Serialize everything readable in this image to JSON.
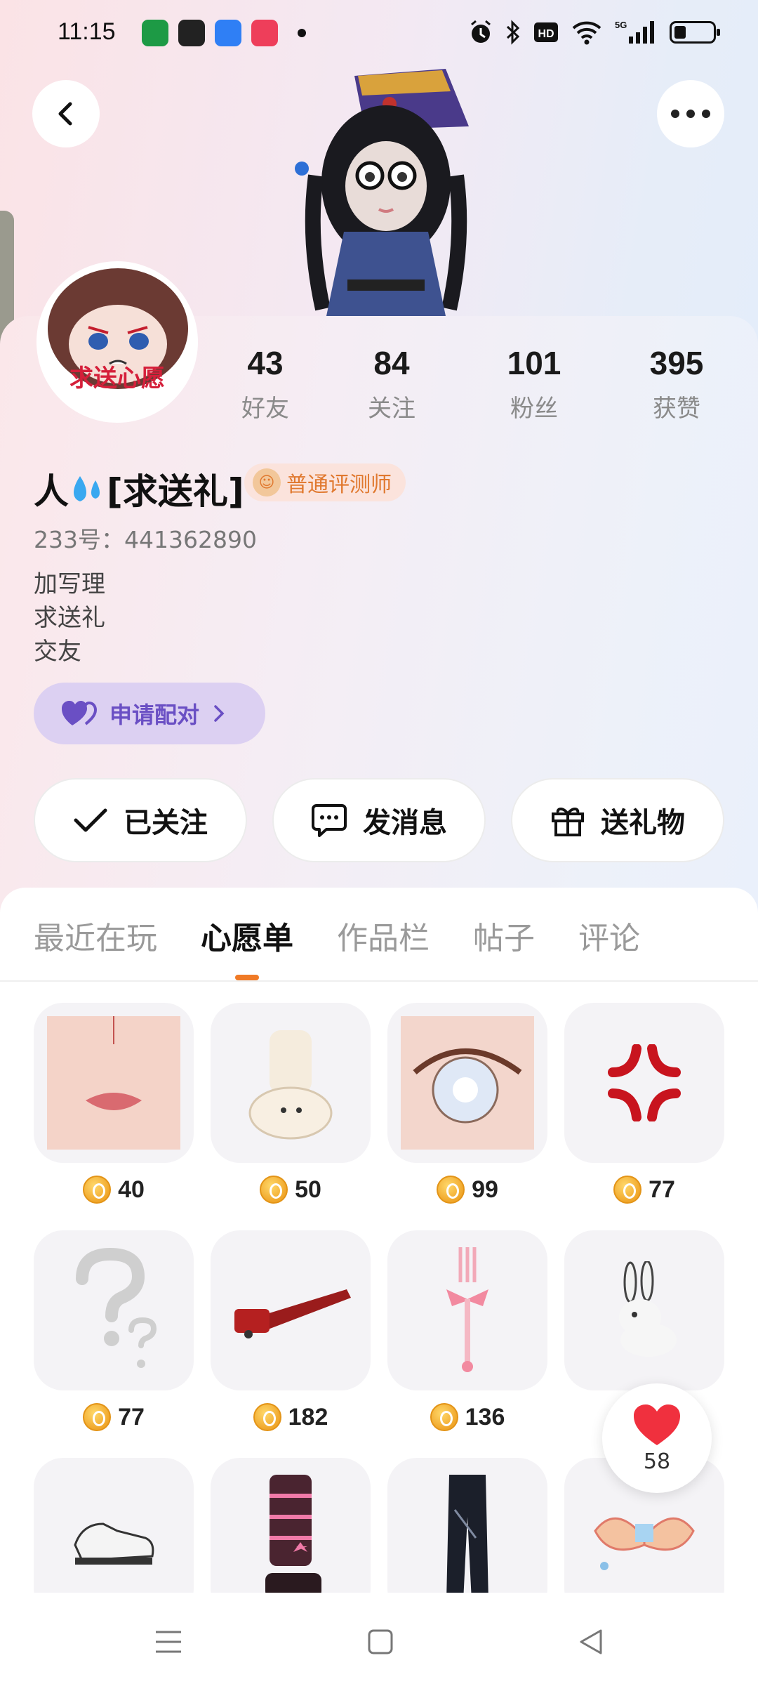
{
  "status_bar": {
    "time": "11:15",
    "network": "5G"
  },
  "profile": {
    "avatar_caption": "求送心愿",
    "stats": [
      {
        "value": "43",
        "label": "好友"
      },
      {
        "value": "84",
        "label": "关注"
      },
      {
        "value": "101",
        "label": "粉丝"
      },
      {
        "value": "395",
        "label": "获赞"
      }
    ],
    "name_prefix": "人",
    "name_suffix": "[求送礼]",
    "badge": "普通评测师",
    "uid": "233号：441362890",
    "bio": [
      "加写理",
      "求送礼",
      "交友"
    ],
    "pair_button": "申请配对"
  },
  "actions": {
    "follow": "已关注",
    "message": "发消息",
    "gift": "送礼物"
  },
  "tabs": [
    {
      "label": "最近在玩",
      "active": false
    },
    {
      "label": "心愿单",
      "active": true
    },
    {
      "label": "作品栏",
      "active": false
    },
    {
      "label": "帖子",
      "active": false
    },
    {
      "label": "评论",
      "active": false
    }
  ],
  "wishlist": [
    {
      "name": "lips",
      "price": "40"
    },
    {
      "name": "bunny-socks",
      "price": "50"
    },
    {
      "name": "eyes",
      "price": "99"
    },
    {
      "name": "anger-mark",
      "price": "77"
    },
    {
      "name": "question-mark",
      "price": "77"
    },
    {
      "name": "chainsaw",
      "price": "182"
    },
    {
      "name": "ribbon-fork",
      "price": "136"
    },
    {
      "name": "white-rabbit",
      "price": ""
    },
    {
      "name": "white-shoes",
      "price": ""
    },
    {
      "name": "platform-boots",
      "price": ""
    },
    {
      "name": "black-pants",
      "price": ""
    },
    {
      "name": "wings",
      "price": ""
    }
  ],
  "floating_like": {
    "count": "58"
  },
  "colors": {
    "accent": "#f07a26",
    "pair_purple": "#6a4fc4",
    "badge_orange": "#e0782e"
  }
}
